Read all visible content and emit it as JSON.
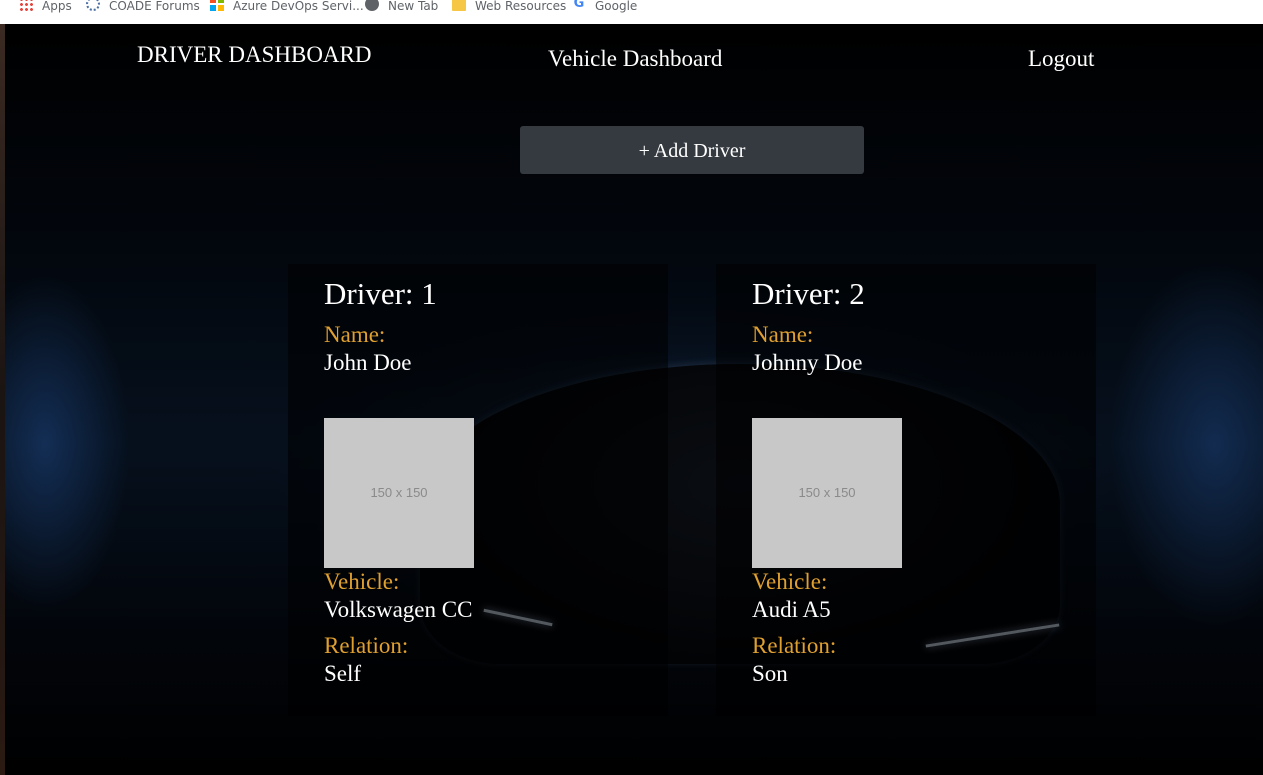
{
  "bookmarks": [
    {
      "label": "Apps",
      "icon": "apps-grid-icon"
    },
    {
      "label": "COADE Forums",
      "icon": "coade-icon"
    },
    {
      "label": "Azure DevOps Servi...",
      "icon": "microsoft-icon"
    },
    {
      "label": "New Tab",
      "icon": "globe-icon"
    },
    {
      "label": "Web Resources",
      "icon": "folder-icon"
    },
    {
      "label": "Google",
      "icon": "google-icon"
    }
  ],
  "nav": {
    "title": "DRIVER DASHBOARD",
    "vehicle_link": "Vehicle Dashboard",
    "logout": "Logout"
  },
  "add_button": "+ Add Driver",
  "drivers": [
    {
      "heading": "Driver: 1",
      "name_label": "Name:",
      "name": "John Doe",
      "photo_placeholder": "150 x 150",
      "vehicle_label": "Vehicle:",
      "vehicle": "Volkswagen CC",
      "relation_label": "Relation:",
      "relation": "Self"
    },
    {
      "heading": "Driver: 2",
      "name_label": "Name:",
      "name": "Johnny Doe",
      "photo_placeholder": "150 x 150",
      "vehicle_label": "Vehicle:",
      "vehicle": "Audi A5",
      "relation_label": "Relation:",
      "relation": "Son"
    }
  ],
  "colors": {
    "accent_label": "#e0a030",
    "button_bg": "#343a40",
    "page_bg": "#000000"
  }
}
